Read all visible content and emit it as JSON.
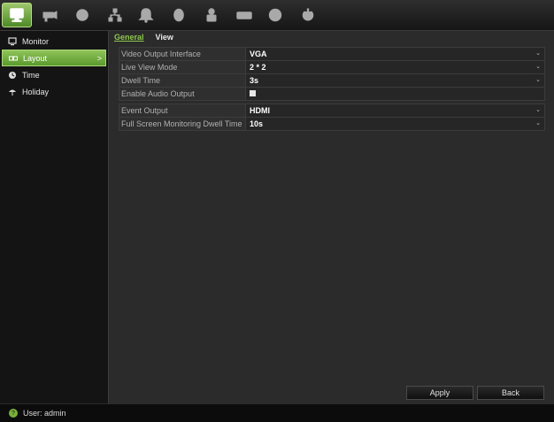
{
  "toolbar": {
    "icons": [
      "display-icon",
      "camera-icon",
      "playback-icon",
      "network-icon",
      "alarm-icon",
      "device-icon",
      "user-icon",
      "hdd-icon",
      "info-icon",
      "power-icon"
    ]
  },
  "sidebar": {
    "items": [
      {
        "label": "Monitor",
        "icon": "monitor-icon"
      },
      {
        "label": "Layout",
        "icon": "layout-icon",
        "arrow": ">"
      },
      {
        "label": "Time",
        "icon": "clock-icon"
      },
      {
        "label": "Holiday",
        "icon": "holiday-icon"
      }
    ]
  },
  "tabs": [
    {
      "label": "General"
    },
    {
      "label": "View"
    }
  ],
  "form": {
    "video_output": {
      "label": "Video Output Interface",
      "value": "VGA"
    },
    "live_view_mode": {
      "label": "Live View Mode",
      "value": "2 * 2"
    },
    "dwell_time": {
      "label": "Dwell Time",
      "value": "3s"
    },
    "enable_audio": {
      "label": "Enable Audio Output",
      "checked": true
    },
    "event_output": {
      "label": "Event Output",
      "value": "HDMI"
    },
    "full_screen_dwell": {
      "label": "Full Screen Monitoring Dwell Time",
      "value": "10s"
    },
    "dropdown_glyph": "⌄"
  },
  "buttons": {
    "apply": "Apply",
    "back": "Back"
  },
  "status": {
    "user_text": "User: admin",
    "user_glyph": "?"
  },
  "colors": {
    "accent": "#79b23a",
    "tab_active": "#8cc84b"
  }
}
